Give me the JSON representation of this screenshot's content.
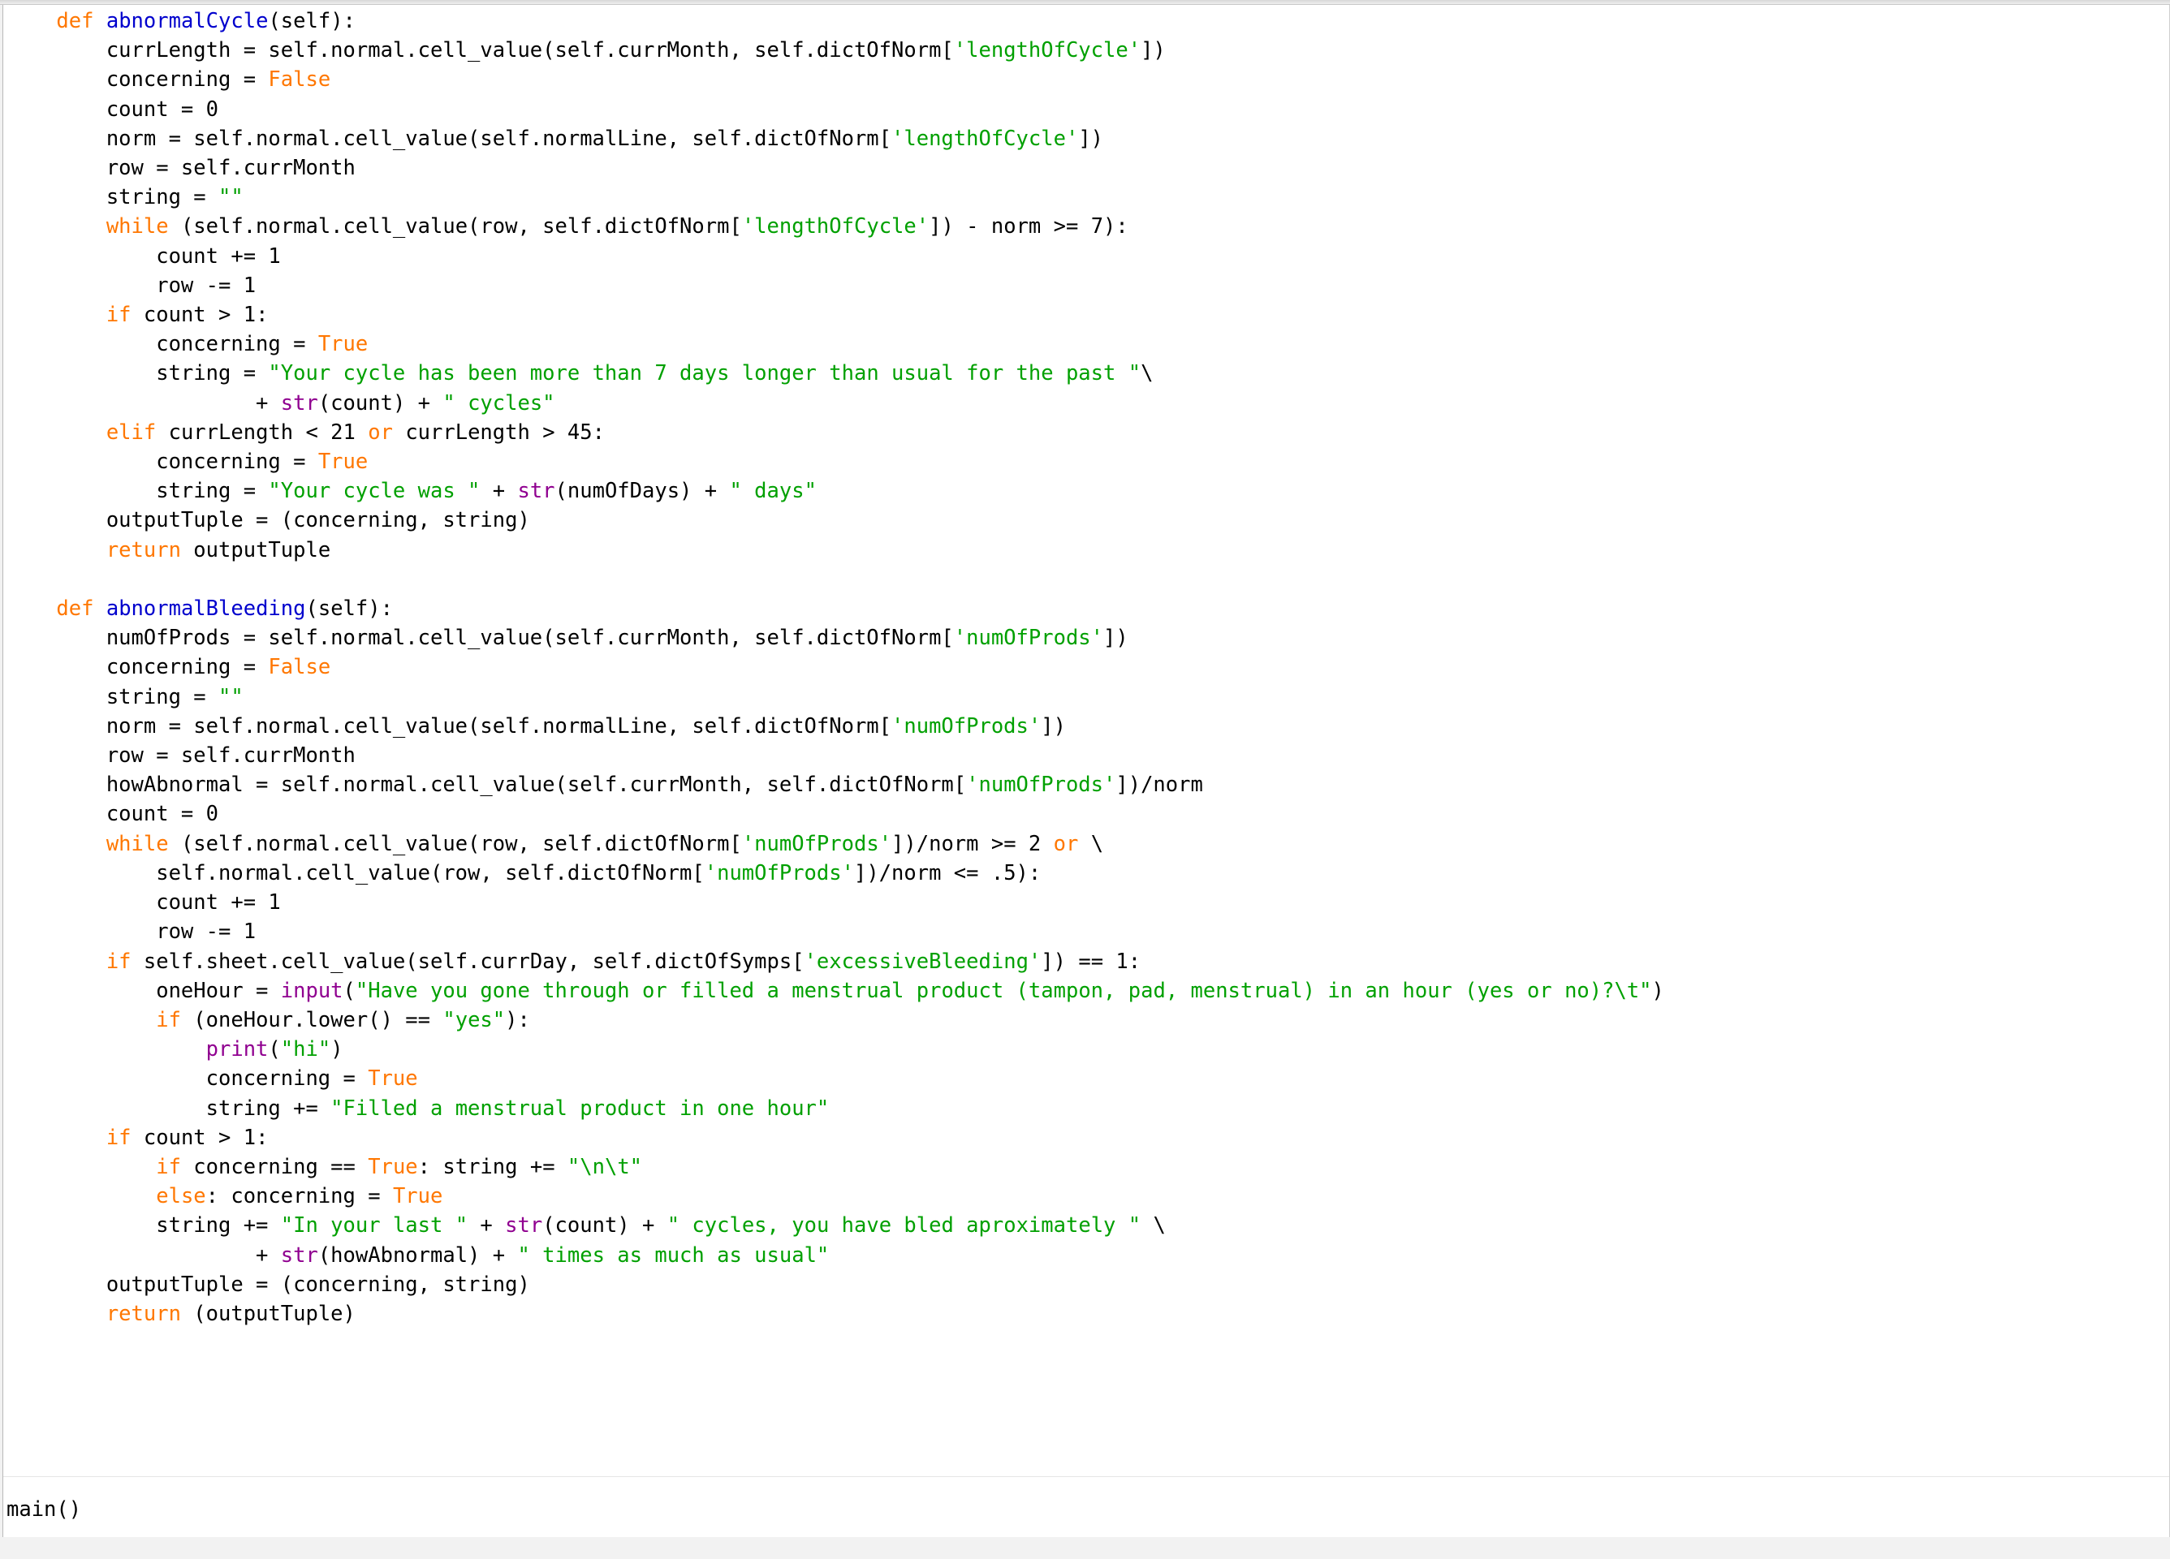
{
  "window": {
    "kind": "code-editor",
    "language": "Python"
  },
  "theme": {
    "background": "#ffffff",
    "chrome": "#f2f2f2",
    "text": "#000000",
    "keyword": "#ff7700",
    "function_name": "#0000cd",
    "string": "#00a000",
    "builtin": "#900090"
  },
  "code": {
    "lines": [
      [
        {
          "t": "    ",
          "c": "pl"
        },
        {
          "t": "def",
          "c": "kw"
        },
        {
          "t": " ",
          "c": "pl"
        },
        {
          "t": "abnormalCycle",
          "c": "fn"
        },
        {
          "t": "(self):",
          "c": "pl"
        }
      ],
      [
        {
          "t": "        currLength = self.normal.cell_value(self.currMonth, self.dictOfNorm[",
          "c": "pl"
        },
        {
          "t": "'lengthOfCycle'",
          "c": "str"
        },
        {
          "t": "])",
          "c": "pl"
        }
      ],
      [
        {
          "t": "        concerning = ",
          "c": "pl"
        },
        {
          "t": "False",
          "c": "kw"
        }
      ],
      [
        {
          "t": "        count = 0",
          "c": "pl"
        }
      ],
      [
        {
          "t": "        norm = self.normal.cell_value(self.normalLine, self.dictOfNorm[",
          "c": "pl"
        },
        {
          "t": "'lengthOfCycle'",
          "c": "str"
        },
        {
          "t": "])",
          "c": "pl"
        }
      ],
      [
        {
          "t": "        row = self.currMonth",
          "c": "pl"
        }
      ],
      [
        {
          "t": "        string = ",
          "c": "pl"
        },
        {
          "t": "\"\"",
          "c": "str"
        }
      ],
      [
        {
          "t": "        ",
          "c": "pl"
        },
        {
          "t": "while",
          "c": "kw"
        },
        {
          "t": " (self.normal.cell_value(row, self.dictOfNorm[",
          "c": "pl"
        },
        {
          "t": "'lengthOfCycle'",
          "c": "str"
        },
        {
          "t": "]) - norm >= 7):",
          "c": "pl"
        }
      ],
      [
        {
          "t": "            count += 1",
          "c": "pl"
        }
      ],
      [
        {
          "t": "            row -= 1",
          "c": "pl"
        }
      ],
      [
        {
          "t": "        ",
          "c": "pl"
        },
        {
          "t": "if",
          "c": "kw"
        },
        {
          "t": " count > 1:",
          "c": "pl"
        }
      ],
      [
        {
          "t": "            concerning = ",
          "c": "pl"
        },
        {
          "t": "True",
          "c": "kw"
        }
      ],
      [
        {
          "t": "            string = ",
          "c": "pl"
        },
        {
          "t": "\"Your cycle has been more than 7 days longer than usual for the past \"",
          "c": "str"
        },
        {
          "t": "\\",
          "c": "pl"
        }
      ],
      [
        {
          "t": "                    + ",
          "c": "pl"
        },
        {
          "t": "str",
          "c": "bi"
        },
        {
          "t": "(count) + ",
          "c": "pl"
        },
        {
          "t": "\" cycles\"",
          "c": "str"
        }
      ],
      [
        {
          "t": "        ",
          "c": "pl"
        },
        {
          "t": "elif",
          "c": "kw"
        },
        {
          "t": " currLength < 21 ",
          "c": "pl"
        },
        {
          "t": "or",
          "c": "kw"
        },
        {
          "t": " currLength > 45:",
          "c": "pl"
        }
      ],
      [
        {
          "t": "            concerning = ",
          "c": "pl"
        },
        {
          "t": "True",
          "c": "kw"
        }
      ],
      [
        {
          "t": "            string = ",
          "c": "pl"
        },
        {
          "t": "\"Your cycle was \"",
          "c": "str"
        },
        {
          "t": " + ",
          "c": "pl"
        },
        {
          "t": "str",
          "c": "bi"
        },
        {
          "t": "(numOfDays) + ",
          "c": "pl"
        },
        {
          "t": "\" days\"",
          "c": "str"
        }
      ],
      [
        {
          "t": "        outputTuple = (concerning, string)",
          "c": "pl"
        }
      ],
      [
        {
          "t": "        ",
          "c": "pl"
        },
        {
          "t": "return",
          "c": "kw"
        },
        {
          "t": " outputTuple",
          "c": "pl"
        }
      ],
      [
        {
          "t": "",
          "c": "pl"
        }
      ],
      [
        {
          "t": "    ",
          "c": "pl"
        },
        {
          "t": "def",
          "c": "kw"
        },
        {
          "t": " ",
          "c": "pl"
        },
        {
          "t": "abnormalBleeding",
          "c": "fn"
        },
        {
          "t": "(self):",
          "c": "pl"
        }
      ],
      [
        {
          "t": "        numOfProds = self.normal.cell_value(self.currMonth, self.dictOfNorm[",
          "c": "pl"
        },
        {
          "t": "'numOfProds'",
          "c": "str"
        },
        {
          "t": "])",
          "c": "pl"
        }
      ],
      [
        {
          "t": "        concerning = ",
          "c": "pl"
        },
        {
          "t": "False",
          "c": "kw"
        }
      ],
      [
        {
          "t": "        string = ",
          "c": "pl"
        },
        {
          "t": "\"\"",
          "c": "str"
        }
      ],
      [
        {
          "t": "        norm = self.normal.cell_value(self.normalLine, self.dictOfNorm[",
          "c": "pl"
        },
        {
          "t": "'numOfProds'",
          "c": "str"
        },
        {
          "t": "])",
          "c": "pl"
        }
      ],
      [
        {
          "t": "        row = self.currMonth",
          "c": "pl"
        }
      ],
      [
        {
          "t": "        howAbnormal = self.normal.cell_value(self.currMonth, self.dictOfNorm[",
          "c": "pl"
        },
        {
          "t": "'numOfProds'",
          "c": "str"
        },
        {
          "t": "])/norm",
          "c": "pl"
        }
      ],
      [
        {
          "t": "        count = 0",
          "c": "pl"
        }
      ],
      [
        {
          "t": "        ",
          "c": "pl"
        },
        {
          "t": "while",
          "c": "kw"
        },
        {
          "t": " (self.normal.cell_value(row, self.dictOfNorm[",
          "c": "pl"
        },
        {
          "t": "'numOfProds'",
          "c": "str"
        },
        {
          "t": "])/norm >= 2 ",
          "c": "pl"
        },
        {
          "t": "or",
          "c": "kw"
        },
        {
          "t": " \\",
          "c": "pl"
        }
      ],
      [
        {
          "t": "            self.normal.cell_value(row, self.dictOfNorm[",
          "c": "pl"
        },
        {
          "t": "'numOfProds'",
          "c": "str"
        },
        {
          "t": "])/norm <= .5):",
          "c": "pl"
        }
      ],
      [
        {
          "t": "            count += 1",
          "c": "pl"
        }
      ],
      [
        {
          "t": "            row -= 1",
          "c": "pl"
        }
      ],
      [
        {
          "t": "        ",
          "c": "pl"
        },
        {
          "t": "if",
          "c": "kw"
        },
        {
          "t": " self.sheet.cell_value(self.currDay, self.dictOfSymps[",
          "c": "pl"
        },
        {
          "t": "'excessiveBleeding'",
          "c": "str"
        },
        {
          "t": "]) == 1:",
          "c": "pl"
        }
      ],
      [
        {
          "t": "            oneHour = ",
          "c": "pl"
        },
        {
          "t": "input",
          "c": "bi"
        },
        {
          "t": "(",
          "c": "pl"
        },
        {
          "t": "\"Have you gone through or filled a menstrual product (tampon, pad, menstrual) in an hour (yes or no)?\\t\"",
          "c": "str"
        },
        {
          "t": ")",
          "c": "pl"
        }
      ],
      [
        {
          "t": "            ",
          "c": "pl"
        },
        {
          "t": "if",
          "c": "kw"
        },
        {
          "t": " (oneHour.lower() == ",
          "c": "pl"
        },
        {
          "t": "\"yes\"",
          "c": "str"
        },
        {
          "t": "):",
          "c": "pl"
        }
      ],
      [
        {
          "t": "                ",
          "c": "pl"
        },
        {
          "t": "print",
          "c": "bi"
        },
        {
          "t": "(",
          "c": "pl"
        },
        {
          "t": "\"hi\"",
          "c": "str"
        },
        {
          "t": ")",
          "c": "pl"
        }
      ],
      [
        {
          "t": "                concerning = ",
          "c": "pl"
        },
        {
          "t": "True",
          "c": "kw"
        }
      ],
      [
        {
          "t": "                string += ",
          "c": "pl"
        },
        {
          "t": "\"Filled a menstrual product in one hour\"",
          "c": "str"
        }
      ],
      [
        {
          "t": "        ",
          "c": "pl"
        },
        {
          "t": "if",
          "c": "kw"
        },
        {
          "t": " count > 1:",
          "c": "pl"
        }
      ],
      [
        {
          "t": "            ",
          "c": "pl"
        },
        {
          "t": "if",
          "c": "kw"
        },
        {
          "t": " concerning == ",
          "c": "pl"
        },
        {
          "t": "True",
          "c": "kw"
        },
        {
          "t": ": string += ",
          "c": "pl"
        },
        {
          "t": "\"\\n\\t\"",
          "c": "str"
        }
      ],
      [
        {
          "t": "            ",
          "c": "pl"
        },
        {
          "t": "else",
          "c": "kw"
        },
        {
          "t": ": concerning = ",
          "c": "pl"
        },
        {
          "t": "True",
          "c": "kw"
        }
      ],
      [
        {
          "t": "            string += ",
          "c": "pl"
        },
        {
          "t": "\"In your last \"",
          "c": "str"
        },
        {
          "t": " + ",
          "c": "pl"
        },
        {
          "t": "str",
          "c": "bi"
        },
        {
          "t": "(count) + ",
          "c": "pl"
        },
        {
          "t": "\" cycles, you have bled aproximately \"",
          "c": "str"
        },
        {
          "t": " \\",
          "c": "pl"
        }
      ],
      [
        {
          "t": "                    + ",
          "c": "pl"
        },
        {
          "t": "str",
          "c": "bi"
        },
        {
          "t": "(howAbnormal) + ",
          "c": "pl"
        },
        {
          "t": "\" times as much as usual\"",
          "c": "str"
        }
      ],
      [
        {
          "t": "        outputTuple = (concerning, string)",
          "c": "pl"
        }
      ],
      [
        {
          "t": "        ",
          "c": "pl"
        },
        {
          "t": "return",
          "c": "kw"
        },
        {
          "t": " (outputTuple)",
          "c": "pl"
        }
      ]
    ]
  },
  "footer": {
    "lines": [
      [
        {
          "t": "main()",
          "c": "pl"
        }
      ]
    ]
  }
}
